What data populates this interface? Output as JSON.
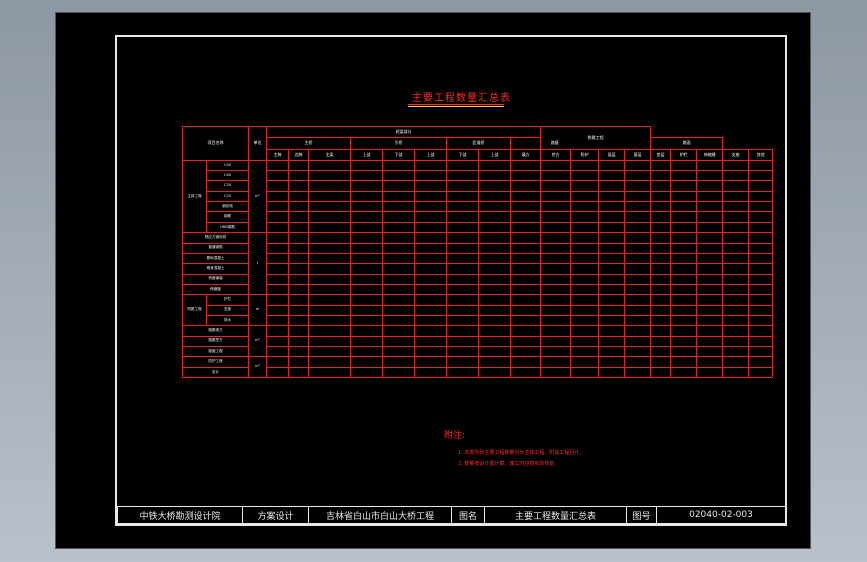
{
  "document": {
    "title": "主要工程数量汇总表"
  },
  "table": {
    "rows": [
      [
        "项目名称",
        "",
        "单位",
        "桥梁部分",
        "",
        "",
        "",
        "",
        "",
        "",
        "",
        "引道部分",
        "",
        "",
        "",
        "",
        "",
        "附属工程",
        "",
        "",
        ""
      ],
      [
        "",
        "",
        "",
        "主桥",
        "",
        "",
        "引桥",
        "",
        "",
        "匝道桥",
        "",
        "路基",
        "",
        "",
        "路面",
        "",
        "",
        "",
        "",
        "",
        ""
      ],
      [
        "",
        "",
        "",
        "主跨",
        "边跨",
        "主梁",
        "上部",
        "下部",
        "上部",
        "下部",
        "上部",
        "填方",
        "挖方",
        "防护",
        "面层",
        "基层",
        "垫层",
        "护栏",
        "伸缩缝",
        "支座",
        "其他"
      ],
      [
        "主体工程",
        "C50",
        "m³",
        "",
        "",
        "",
        "",
        "",
        "",
        "",
        "",
        "",
        "",
        "",
        "",
        "",
        "",
        "",
        "",
        "",
        ""
      ],
      [
        "",
        "C40",
        "",
        "",
        "",
        "",
        "",
        "",
        "",
        "",
        "",
        "",
        "",
        "",
        "",
        "",
        "",
        "",
        "",
        "",
        ""
      ],
      [
        "",
        "C30",
        "",
        "",
        "",
        "",
        "",
        "",
        "",
        "",
        "",
        "",
        "",
        "",
        "",
        "",
        "",
        "",
        "",
        "",
        ""
      ],
      [
        "",
        "C25",
        "",
        "",
        "",
        "",
        "",
        "",
        "",
        "",
        "",
        "",
        "",
        "",
        "",
        "",
        "",
        "",
        "",
        "",
        ""
      ],
      [
        "",
        "钢绞线",
        "",
        "",
        "",
        "",
        "",
        "",
        "",
        "",
        "",
        "",
        "",
        "",
        "",
        "",
        "",
        "",
        "",
        "",
        ""
      ],
      [
        "",
        "钢筋",
        "",
        "",
        "",
        "",
        "",
        "",
        "",
        "",
        "",
        "",
        "",
        "",
        "",
        "",
        "",
        "",
        "",
        "",
        ""
      ],
      [
        "",
        "HRB钢筋",
        "",
        "",
        "",
        "",
        "",
        "",
        "",
        "",
        "",
        "",
        "",
        "",
        "",
        "",
        "",
        "",
        "",
        "",
        ""
      ],
      [
        "预应力钢绞线",
        "",
        "t",
        "",
        "",
        "",
        "",
        "",
        "",
        "",
        "",
        "",
        "",
        "",
        "",
        "",
        "",
        "",
        "",
        "",
        ""
      ],
      [
        "普通钢筋",
        "",
        "",
        "",
        "",
        "",
        "",
        "",
        "",
        "",
        "",
        "",
        "",
        "",
        "",
        "",
        "",
        "",
        "",
        "",
        ""
      ],
      [
        "基础混凝土",
        "",
        "",
        "",
        "",
        "",
        "",
        "",
        "",
        "",
        "",
        "",
        "",
        "",
        "",
        "",
        "",
        "",
        "",
        "",
        ""
      ],
      [
        "墩身混凝土",
        "",
        "",
        "",
        "",
        "",
        "",
        "",
        "",
        "",
        "",
        "",
        "",
        "",
        "",
        "",
        "",
        "",
        "",
        "",
        ""
      ],
      [
        "桥面铺装",
        "",
        "",
        "",
        "",
        "",
        "",
        "",
        "",
        "",
        "",
        "",
        "",
        "",
        "",
        "",
        "",
        "",
        "",
        "",
        ""
      ],
      [
        "伸缩缝",
        "",
        "",
        "",
        "",
        "",
        "",
        "",
        "",
        "",
        "",
        "",
        "",
        "",
        "",
        "",
        "",
        "",
        "",
        "",
        ""
      ],
      [
        "附属工程",
        "护栏",
        "m",
        "",
        "",
        "",
        "",
        "",
        "",
        "",
        "",
        "",
        "",
        "",
        "",
        "",
        "",
        "",
        "",
        "",
        ""
      ],
      [
        "",
        "支座",
        "",
        "",
        "",
        "",
        "",
        "",
        "",
        "",
        "",
        "",
        "",
        "",
        "",
        "",
        "",
        "",
        "",
        "",
        ""
      ],
      [
        "",
        "排水",
        "",
        "",
        "",
        "",
        "",
        "",
        "",
        "",
        "",
        "",
        "",
        "",
        "",
        "",
        "",
        "",
        "",
        "",
        ""
      ],
      [
        "路基填方",
        "",
        "m³",
        "",
        "",
        "",
        "",
        "",
        "",
        "",
        "",
        "",
        "",
        "",
        "",
        "",
        "",
        "",
        "",
        "",
        ""
      ],
      [
        "路基挖方",
        "",
        "",
        "",
        "",
        "",
        "",
        "",
        "",
        "",
        "",
        "",
        "",
        "",
        "",
        "",
        "",
        "",
        "",
        "",
        ""
      ],
      [
        "路面工程",
        "",
        "",
        "",
        "",
        "",
        "",
        "",
        "",
        "",
        "",
        "",
        "",
        "",
        "",
        "",
        "",
        "",
        "",
        "",
        ""
      ],
      [
        "防护工程",
        "",
        "m³",
        "",
        "",
        "",
        "",
        "",
        "",
        "",
        "",
        "",
        "",
        "",
        "",
        "",
        "",
        "",
        "",
        "",
        ""
      ],
      [
        "总计",
        "",
        "",
        "",
        "",
        "",
        "",
        "",
        "",
        "",
        "",
        "",
        "",
        "",
        "",
        "",
        "",
        "",
        "",
        "",
        ""
      ]
    ]
  },
  "notes": {
    "title": "附注:",
    "items": [
      "1. 本表所列主要工程数量均为主体工程，附属工程另计。",
      "2. 数量按设计图计算，施工时应按实际核定。"
    ]
  },
  "titleblock": {
    "company": "中铁大桥勘测设计院",
    "stage": "方案设计",
    "project": "吉林省白山市白山大桥工程",
    "drawing_name_label": "图名",
    "drawing_name": "主要工程数量汇总表",
    "drawing_no_label": "图号",
    "drawing_no": "02040-02-003"
  }
}
